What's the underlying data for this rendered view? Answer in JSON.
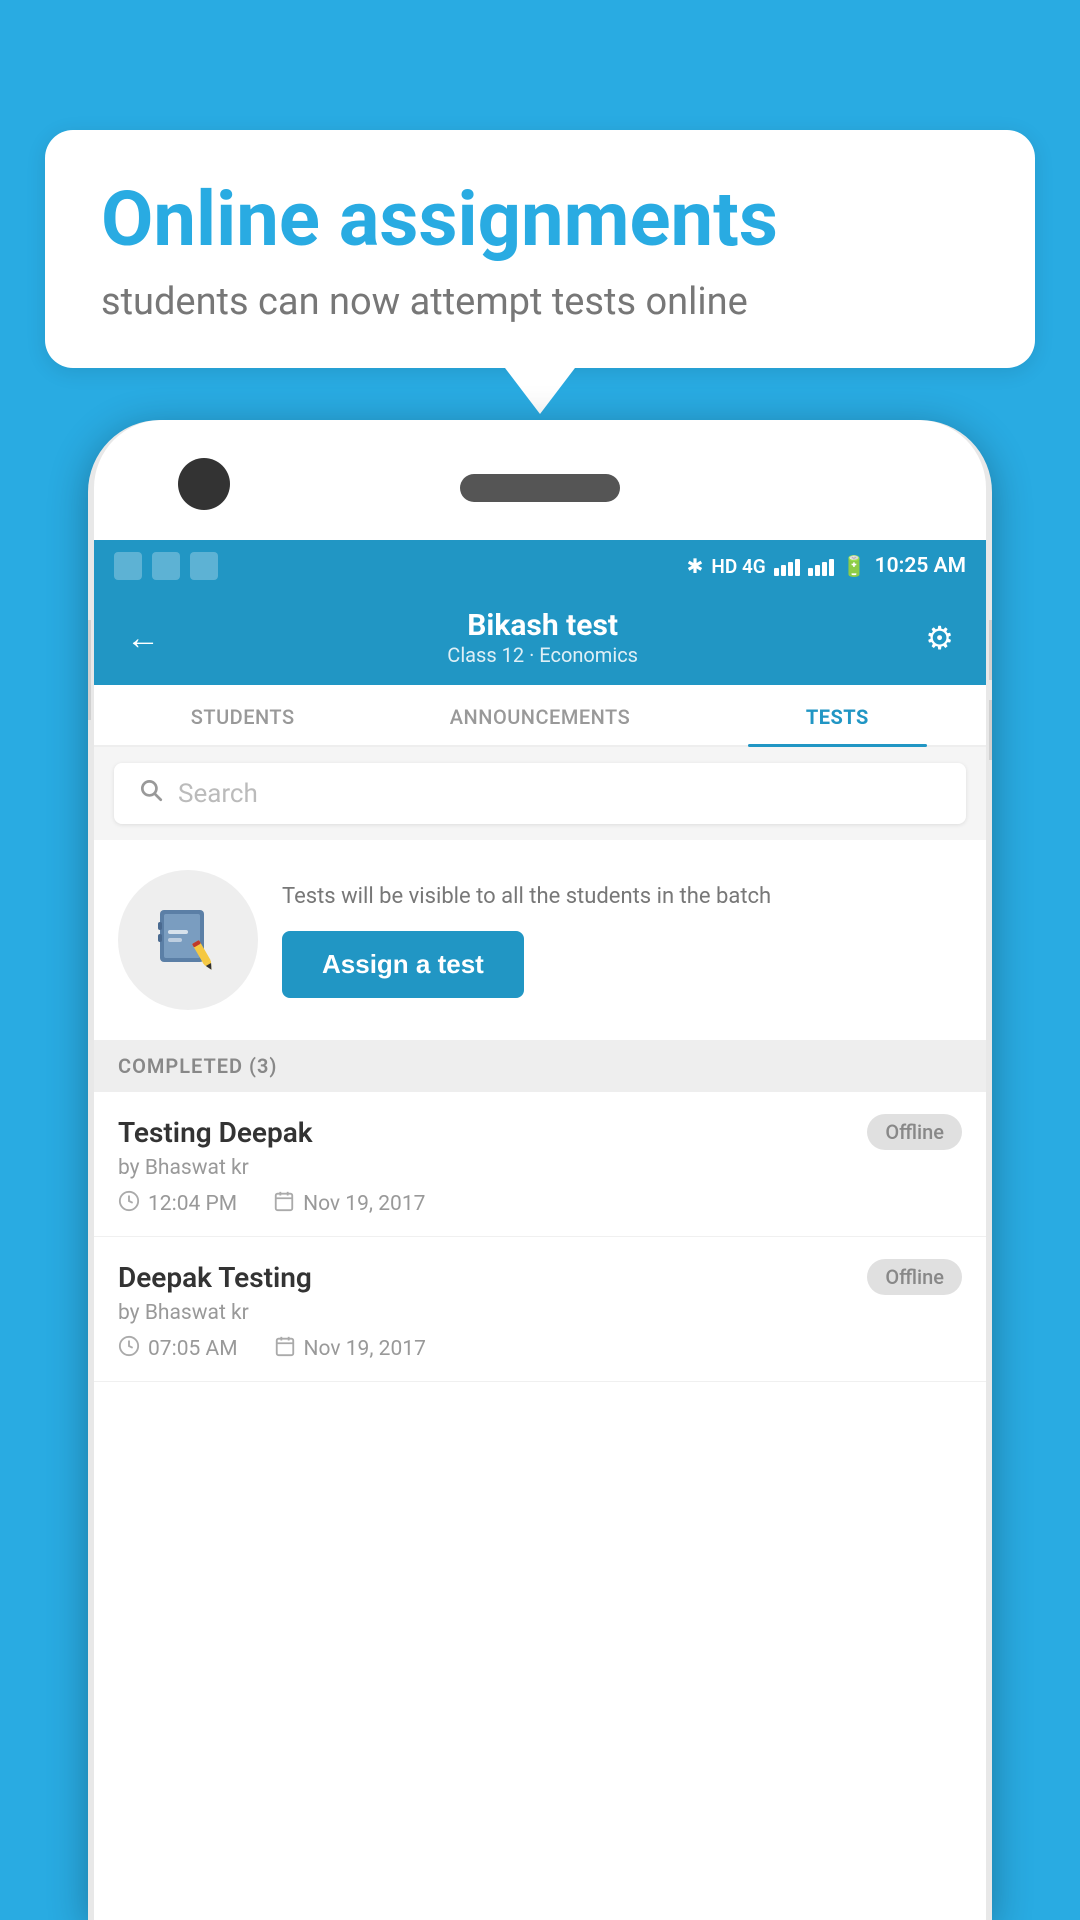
{
  "background": {
    "color": "#29ABE2"
  },
  "bubble": {
    "title": "Online assignments",
    "subtitle": "students can now attempt tests online"
  },
  "status_bar": {
    "time": "10:25 AM",
    "network": "HD 4G"
  },
  "header": {
    "title": "Bikash test",
    "subtitle": "Class 12 · Economics",
    "back_label": "←",
    "settings_label": "⚙"
  },
  "tabs": [
    {
      "label": "STUDENTS",
      "active": false
    },
    {
      "label": "ANNOUNCEMENTS",
      "active": false
    },
    {
      "label": "TESTS",
      "active": true
    }
  ],
  "search": {
    "placeholder": "Search"
  },
  "assign_section": {
    "description": "Tests will be visible to all the students in the batch",
    "button_label": "Assign a test"
  },
  "completed": {
    "header": "COMPLETED (3)",
    "items": [
      {
        "name": "Testing Deepak",
        "author": "by Bhaswat kr",
        "time": "12:04 PM",
        "date": "Nov 19, 2017",
        "badge": "Offline"
      },
      {
        "name": "Deepak Testing",
        "author": "by Bhaswat kr",
        "time": "07:05 AM",
        "date": "Nov 19, 2017",
        "badge": "Offline"
      }
    ]
  }
}
